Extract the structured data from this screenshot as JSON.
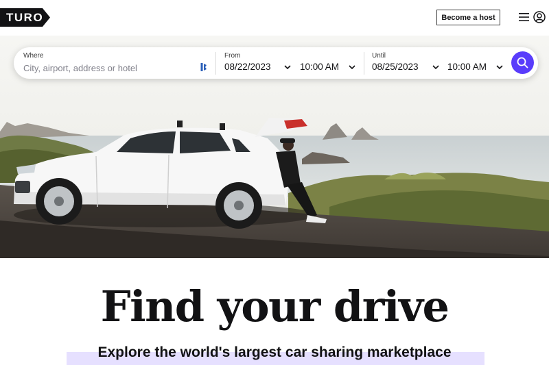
{
  "header": {
    "logo_text": "TURO",
    "become_host_label": "Become a host",
    "menu_icon": "hamburger-menu-icon",
    "user_icon": "user-circle-icon"
  },
  "search": {
    "where": {
      "label": "Where",
      "placeholder": "City, airport, address or hotel",
      "icon": "location-pin-icon"
    },
    "from": {
      "label": "From",
      "date": "08/22/2023",
      "time": "10:00 AM"
    },
    "until": {
      "label": "Until",
      "date": "08/25/2023",
      "time": "10:00 AM"
    },
    "submit_icon": "search-icon"
  },
  "hero": {
    "image": "white SUV parked on coastal overlook, person leaning on open tailgate, sea stacks in background"
  },
  "main": {
    "headline": "Find your drive",
    "subheadline": "Explore the world's largest car sharing marketplace"
  },
  "colors": {
    "brand_black": "#121214",
    "accent_purple": "#593cfb",
    "highlight_lavender": "#e6e0ff"
  }
}
